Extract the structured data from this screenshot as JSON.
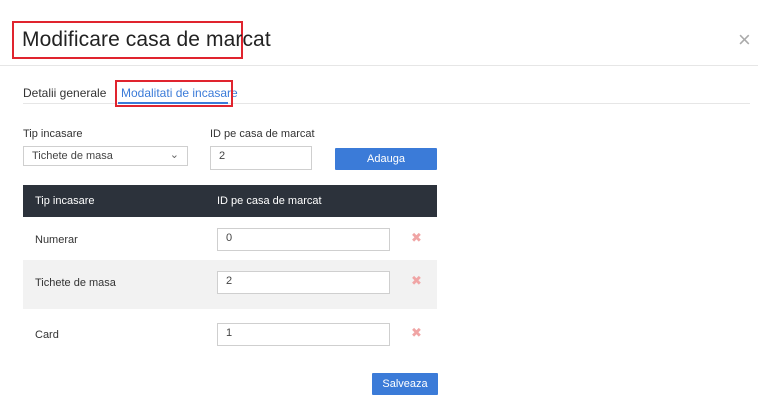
{
  "dialog": {
    "title": "Modificare casa de marcat",
    "close_glyph": "×"
  },
  "tabs": [
    {
      "label": "Detalii generale",
      "active": false
    },
    {
      "label": "Modalitati de incasare",
      "active": true
    }
  ],
  "form": {
    "tip_label": "Tip incasare",
    "tip_value": "Tichete de masa",
    "id_label": "ID pe casa de marcat",
    "id_value": "2",
    "add_label": "Adauga"
  },
  "table": {
    "headers": [
      "Tip incasare",
      "ID pe casa de marcat"
    ],
    "rows": [
      {
        "name": "Numerar",
        "id": "0"
      },
      {
        "name": "Tichete de masa",
        "id": "2"
      },
      {
        "name": "Card",
        "id": "1"
      }
    ]
  },
  "footer": {
    "save_label": "Salveaza"
  },
  "colors": {
    "accent": "#3b7bd8",
    "header_bg": "#2c323b",
    "highlight": "#e0242e"
  }
}
